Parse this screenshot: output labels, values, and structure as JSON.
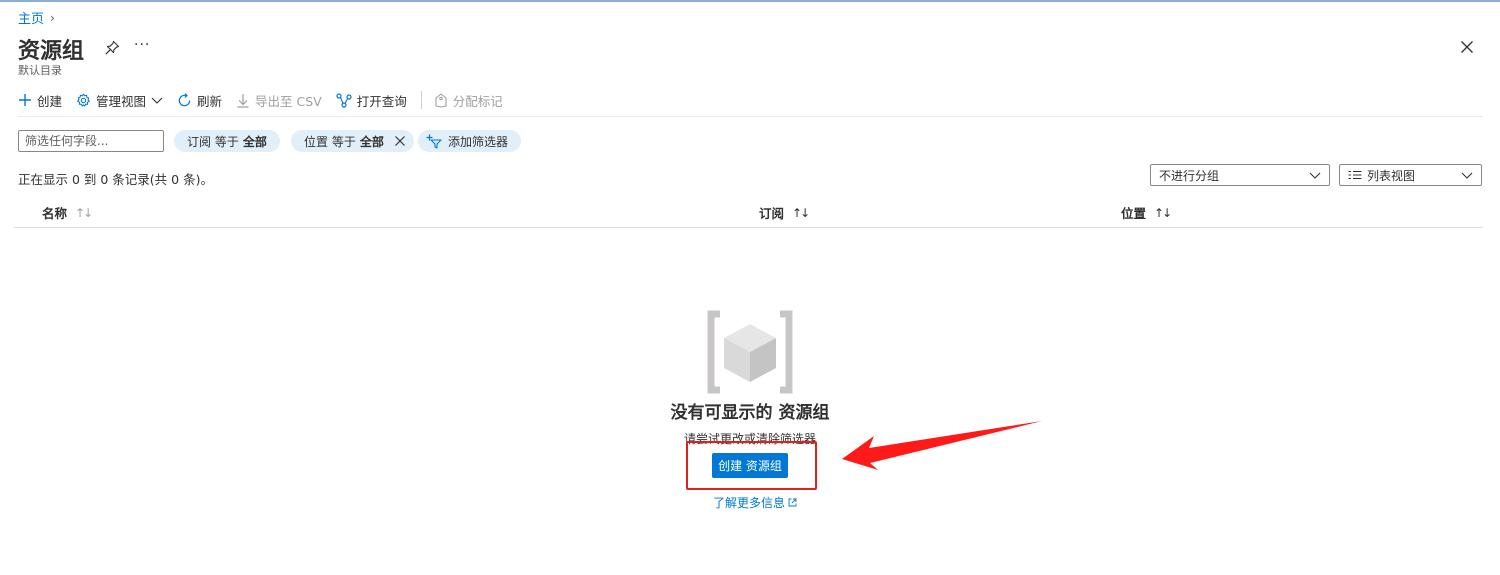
{
  "breadcrumb": {
    "home": "主页",
    "separator": "›"
  },
  "header": {
    "title": "资源组",
    "subtitle": "默认目录",
    "more": "···"
  },
  "toolbar": {
    "create": "创建",
    "manage_view": "管理视图",
    "refresh": "刷新",
    "export_csv": "导出至 CSV",
    "open_query": "打开查询",
    "assign_tags": "分配标记"
  },
  "filters": {
    "placeholder": "筛选任何字段...",
    "subscription_prefix": "订阅 等于",
    "subscription_value": "全部",
    "location_prefix": "位置 等于",
    "location_value": "全部",
    "add_filter": "添加筛选器"
  },
  "records": "正在显示 0 到 0 条记录(共 0 条)。",
  "grouping": {
    "selected": "不进行分组"
  },
  "view": {
    "selected": "列表视图"
  },
  "columns": [
    {
      "label": "名称",
      "sort": "↑↓"
    },
    {
      "label": "订阅",
      "sort": "↑↓"
    },
    {
      "label": "位置",
      "sort": "↑↓"
    }
  ],
  "empty_state": {
    "title": "没有可显示的 资源组",
    "hint": "请尝试更改或清除筛选器",
    "create_button": "创建 资源组",
    "learn_more": "了解更多信息"
  },
  "colors": {
    "accent": "#0078d4",
    "pill_bg": "#e1effa",
    "annotation_red": "#e02020"
  }
}
